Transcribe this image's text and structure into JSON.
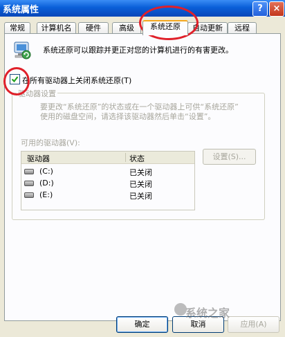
{
  "window": {
    "title": "系统属性",
    "help_label": "?",
    "close_label": "×"
  },
  "tabs": [
    {
      "label": "常规"
    },
    {
      "label": "计算机名"
    },
    {
      "label": "硬件"
    },
    {
      "label": "高级"
    },
    {
      "label": "系统还原",
      "active": true
    },
    {
      "label": "自动更新"
    },
    {
      "label": "远程"
    }
  ],
  "intro_text": "系统还原可以跟踪并更正对您的计算机进行的有害更改。",
  "checkbox": {
    "label": "在所有驱动器上关闭系统还原(T)",
    "checked": true
  },
  "drive_settings": {
    "group_title": "驱动器设置",
    "description_line1": "要更改“系统还原”的状态或在一个驱动器上可供“系统还原”",
    "description_line2": "使用的磁盘空间，请选择该驱动器然后单击“设置”。",
    "available_label": "可用的驱动器(V):",
    "settings_button": "设置(S)...",
    "columns": {
      "drive": "驱动器",
      "status": "状态"
    },
    "drives": [
      {
        "name": "(C:)",
        "status": "已关闭"
      },
      {
        "name": "(D:)",
        "status": "已关闭"
      },
      {
        "name": "(E:)",
        "status": "已关闭"
      }
    ]
  },
  "buttons": {
    "ok": "确定",
    "cancel": "取消",
    "apply": "应用(A)"
  },
  "watermark": "系统之家",
  "colors": {
    "annotation": "#e0202a",
    "active_tab_accent": "#f5a81e"
  }
}
